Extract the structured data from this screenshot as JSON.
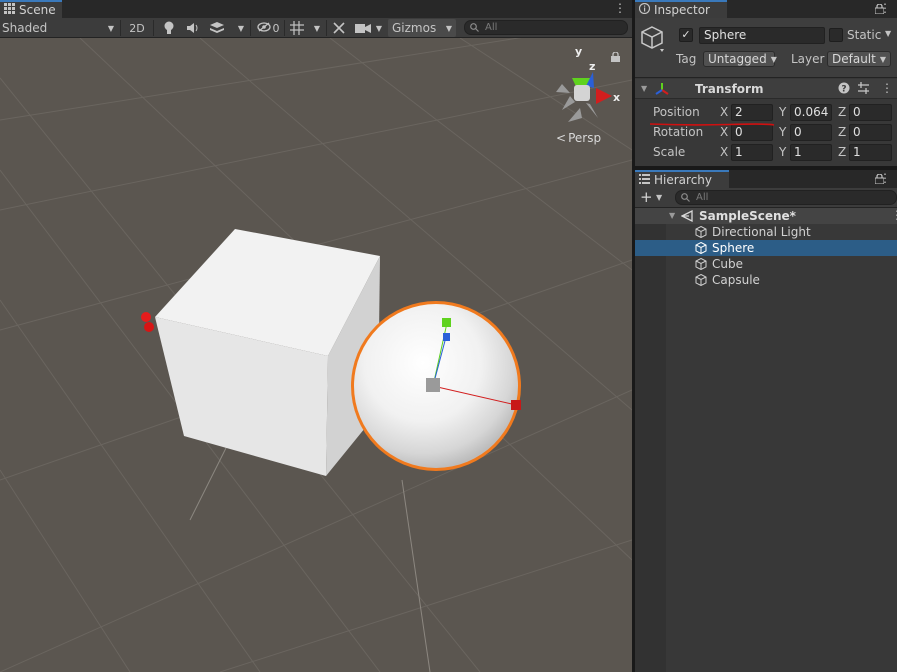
{
  "scene": {
    "tab_label": "Scene",
    "shading_mode": "Shaded",
    "btn_2d": "2D",
    "hidden_count": "0",
    "gizmos_label": "Gizmos",
    "search_placeholder": "All",
    "projection_label": "Persp",
    "axes": {
      "x": "x",
      "y": "y",
      "z": "z"
    }
  },
  "inspector": {
    "tab_label": "Inspector",
    "object_name": "Sphere",
    "active": true,
    "static_label": "Static",
    "tag_label": "Tag",
    "tag_value": "Untagged",
    "layer_label": "Layer",
    "layer_value": "Default",
    "transform": {
      "title": "Transform",
      "rows": [
        {
          "label": "Position",
          "x": "2",
          "y": "0.064",
          "z": "0"
        },
        {
          "label": "Rotation",
          "x": "0",
          "y": "0",
          "z": "0"
        },
        {
          "label": "Scale",
          "x": "1",
          "y": "1",
          "z": "1"
        }
      ],
      "axis_labels": {
        "x": "X",
        "y": "Y",
        "z": "Z"
      }
    }
  },
  "hierarchy": {
    "tab_label": "Hierarchy",
    "search_placeholder": "All",
    "scene_name": "SampleScene*",
    "items": [
      {
        "label": "Directional Light",
        "selected": false
      },
      {
        "label": "Sphere",
        "selected": true
      },
      {
        "label": "Cube",
        "selected": false
      },
      {
        "label": "Capsule",
        "selected": false
      }
    ]
  },
  "colors": {
    "selection_outline": "#f07a1e",
    "axis_x": "#d21e1e",
    "axis_y": "#5fd21e",
    "axis_z": "#2a5fd8",
    "selected_row": "#2c5d87",
    "annotation_underline": "#d01010"
  }
}
